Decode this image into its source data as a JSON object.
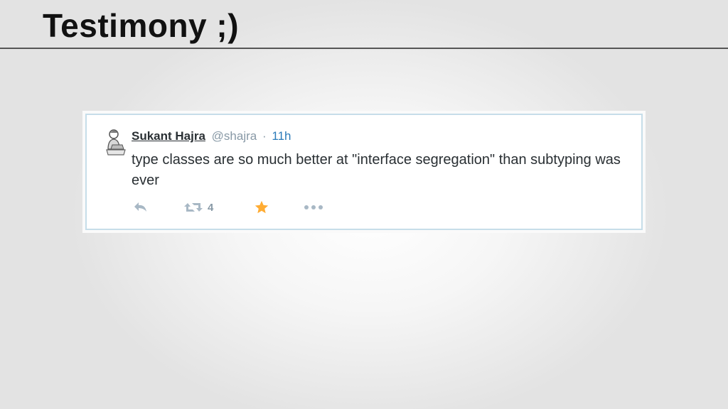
{
  "slide": {
    "title": "Testimony ;)"
  },
  "tweet": {
    "author_name": "Sukant Hajra",
    "handle": "@shajra",
    "separator": "·",
    "time": "11h",
    "text": "type classes are so much better at \"interface segregation\" than subtyping was ever",
    "actions": {
      "retweet_count": "4"
    },
    "icons": {
      "avatar": "person-icon",
      "reply": "reply-icon",
      "retweet": "retweet-icon",
      "favorite": "star-icon",
      "more": "more-icon"
    },
    "colors": {
      "name": "#292f33",
      "handle": "#8899a6",
      "time": "#2b7bb9",
      "favorite": "#ffac33",
      "card_border": "#c6dde9"
    }
  }
}
